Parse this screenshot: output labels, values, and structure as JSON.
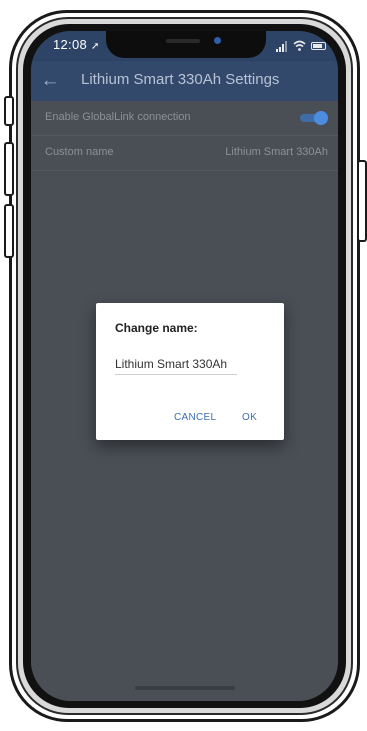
{
  "status_bar": {
    "time": "12:08",
    "location_glyph": "➚"
  },
  "app_bar": {
    "back_glyph": "←",
    "title": "Lithium Smart 330Ah Settings"
  },
  "settings": {
    "rows": [
      {
        "label": "Enable GlobalLink connection",
        "toggle_on": true
      },
      {
        "label": "Custom name",
        "value": "Lithium Smart 330Ah"
      }
    ]
  },
  "dialog": {
    "title": "Change name:",
    "input_value": "Lithium Smart 330Ah",
    "cancel_label": "CANCEL",
    "ok_label": "OK"
  },
  "colors": {
    "app_bar": "#33496c",
    "accent": "#4c8ce0",
    "button_text": "#3b6fb6",
    "overlay_bg": "#4a4f55"
  },
  "icons": [
    "back-arrow-icon",
    "location-arrow-icon",
    "signal-icon",
    "wifi-icon",
    "battery-icon"
  ]
}
